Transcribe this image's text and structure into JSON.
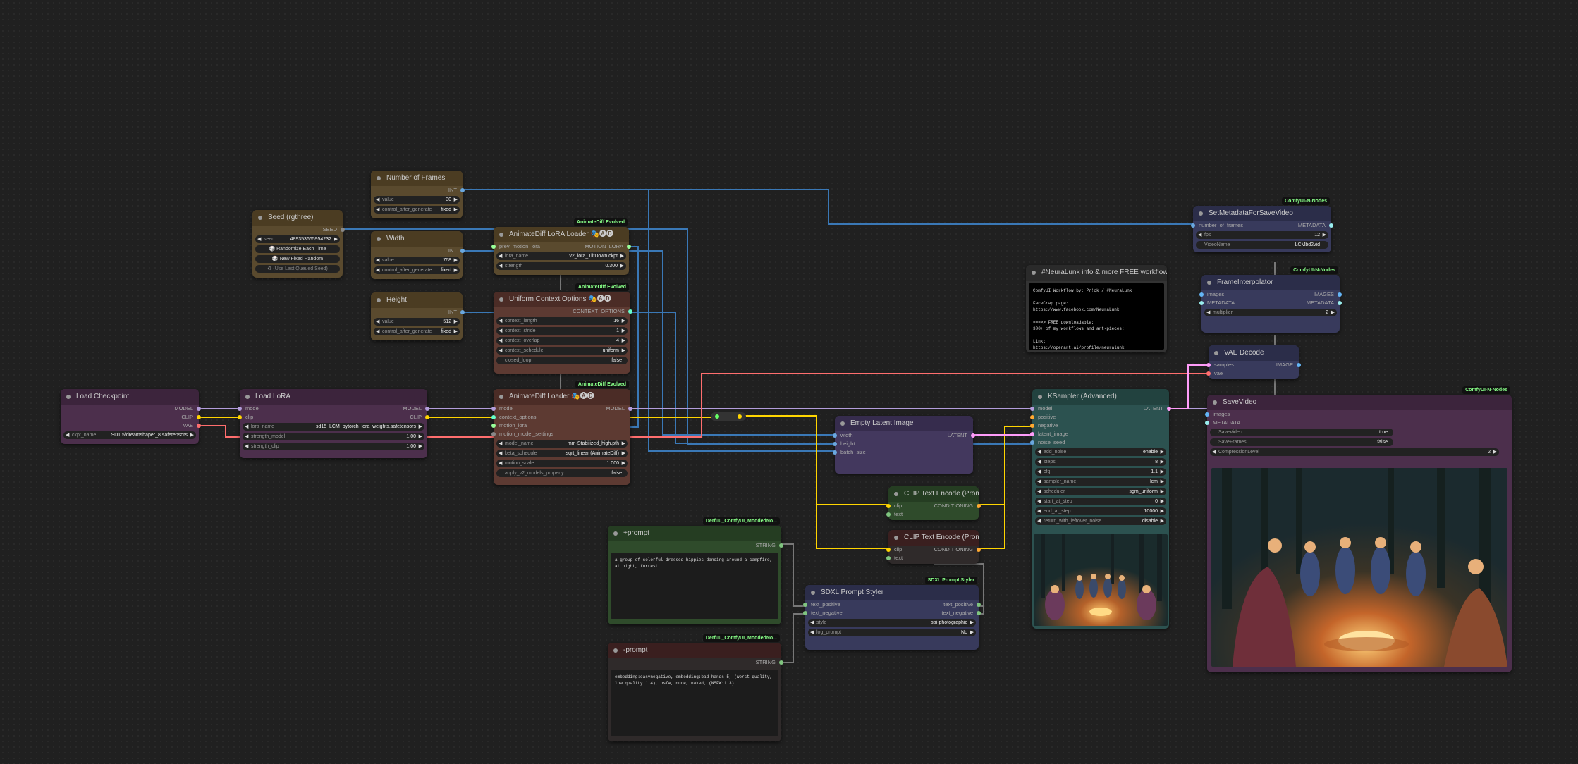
{
  "colors": {
    "wire_model": "#b39ddb",
    "wire_clip": "#ffd500",
    "wire_vae": "#ff6e6e",
    "wire_int": "#3a78b6",
    "wire_latent": "#ff9cf9",
    "wire_cond": "#ffa931",
    "wire_gray": "#777777"
  },
  "nodes": {
    "frames": {
      "title": "Number of Frames",
      "out": "INT",
      "w_value_k": "value",
      "w_value_v": "30",
      "w_cag_k": "control_after_generate",
      "w_cag_v": "fixed"
    },
    "seed": {
      "title": "Seed (rgthree)",
      "out": "SEED",
      "seed_k": "seed",
      "seed_v": "489353665954232",
      "btn1": "🎲 Randomize Each Time",
      "btn2": "🎲 New Fixed Random",
      "btn3": "♻ (Use Last Queued Seed)"
    },
    "width": {
      "title": "Width",
      "out": "INT",
      "w_value_k": "value",
      "w_value_v": "768",
      "w_cag_k": "control_after_generate",
      "w_cag_v": "fixed"
    },
    "height": {
      "title": "Height",
      "out": "INT",
      "w_value_k": "value",
      "w_value_v": "512",
      "w_cag_k": "control_after_generate",
      "w_cag_v": "fixed"
    },
    "lora_loader_ad": {
      "title": "AnimateDiff LoRA Loader 🎭🅐🅓",
      "badge": "AnimateDiff Evolved",
      "in1": "prev_motion_lora",
      "out1": "MOTION_LORA",
      "w1k": "lora_name",
      "w1v": "v2_lora_TiltDown.ckpt",
      "w2k": "strength",
      "w2v": "0.300"
    },
    "uco": {
      "title": "Uniform Context Options 🎭🅐🅓",
      "badge": "AnimateDiff Evolved",
      "out1": "CONTEXT_OPTIONS",
      "w1k": "context_length",
      "w1v": "16",
      "w2k": "context_stride",
      "w2v": "1",
      "w3k": "context_overlap",
      "w3v": "4",
      "w4k": "context_schedule",
      "w4v": "uniform",
      "w5k": "closed_loop",
      "w5v": "false"
    },
    "ckpt": {
      "title": "Load Checkpoint",
      "o1": "MODEL",
      "o2": "CLIP",
      "o3": "VAE",
      "wk": "ckpt_name",
      "wv": "SD1.5\\dreamshaper_8.safetensors"
    },
    "lora": {
      "title": "Load LoRA",
      "i1": "model",
      "i2": "clip",
      "o1": "MODEL",
      "o2": "CLIP",
      "w1k": "lora_name",
      "w1v": "sd15_LCM_pytorch_lora_weights.safetensors",
      "w2k": "strength_model",
      "w2v": "1.00",
      "w3k": "strength_clip",
      "w3v": "1.00"
    },
    "adloader": {
      "title": "AnimateDiff Loader 🎭🅐🅓",
      "badge": "AnimateDiff Evolved",
      "i1": "model",
      "i2": "context_options",
      "i3": "motion_lora",
      "i4": "motion_model_settings",
      "o1": "MODEL",
      "w1k": "model_name",
      "w1v": "mm-Stabilized_high.pth",
      "w2k": "beta_schedule",
      "w2v": "sqrt_linear (AnimateDiff)",
      "w3k": "motion_scale",
      "w3v": "1.000",
      "w4k": "apply_v2_models_properly",
      "w4v": "false"
    },
    "empty_latent": {
      "title": "Empty Latent Image",
      "i1": "width",
      "i2": "height",
      "i3": "batch_size",
      "o1": "LATENT"
    },
    "clip1": {
      "title": "CLIP Text Encode (Prompt)",
      "i1": "clip",
      "i2": "text",
      "o1": "CONDITIONING"
    },
    "clip2": {
      "title": "CLIP Text Encode (Prompt)",
      "i1": "clip",
      "i2": "text",
      "o1": "CONDITIONING"
    },
    "pos": {
      "title": "+prompt",
      "badge": "Derfuu_ComfyUI_ModdedNo...",
      "o1": "STRING",
      "text": "a group of colorful dressed hippies dancing around a campfire, at night, forrest,"
    },
    "neg": {
      "title": "-prompt",
      "badge": "Derfuu_ComfyUI_ModdedNo...",
      "o1": "STRING",
      "text": "embedding:easynegative, embedding:bad-hands-5, (worst quality, low quality:1.4), nsfw, nude, naked, (NSFW:1.3),"
    },
    "styler": {
      "title": "SDXL Prompt Styler",
      "badge": "SDXL Prompt Styler",
      "i1": "text_positive",
      "i2": "text_negative",
      "o1": "text_positive",
      "o2": "text_negative",
      "w1k": "style",
      "w1v": "sai-photographic",
      "w2k": "log_prompt",
      "w2v": "No"
    },
    "ksampler": {
      "title": "KSampler (Advanced)",
      "i1": "model",
      "i2": "positive",
      "i3": "negative",
      "i4": "latent_image",
      "i5": "noise_seed",
      "o1": "LATENT",
      "w": [
        [
          "add_noise",
          "enable"
        ],
        [
          "steps",
          "8"
        ],
        [
          "cfg",
          "1.1"
        ],
        [
          "sampler_name",
          "lcm"
        ],
        [
          "scheduler",
          "sgm_uniform"
        ],
        [
          "start_at_step",
          "0"
        ],
        [
          "end_at_step",
          "10000"
        ],
        [
          "return_with_leftover_noise",
          "disable"
        ]
      ]
    },
    "info": {
      "title": "#NeuraLunk info & more FREE workflows",
      "text": "ComfyUI Workflow by: Pr!ck / #NeuraLunk\n\nFaceCrap page:\nhttps://www.facebook.com/NeuraLunk\n\n===>> FREE downloadable:\n300+ of my workflows and art-pieces:\n\nLink:\nhttps://openart.ai/profile/neuralunk"
    },
    "setmeta": {
      "title": "SetMetadataForSaveVideo",
      "badge": "ComfyUI-N-Nodes",
      "i1": "number_of_frames",
      "o1": "METADATA",
      "w1k": "fps",
      "w1v": "12",
      "w2k": "VideoName",
      "w2v": "LCMbd2vid"
    },
    "interp": {
      "title": "FrameInterpolator",
      "badge": "ComfyUI-N-Nodes",
      "i1": "images",
      "i2": "METADATA",
      "o1": "IMAGES",
      "o2": "METADATA",
      "w1k": "multiplier",
      "w1v": "2"
    },
    "vae": {
      "title": "VAE Decode",
      "i1": "samples",
      "i2": "vae",
      "o1": "IMAGE"
    },
    "save": {
      "title": "SaveVideo",
      "badge": "ComfyUI-N-Nodes",
      "i1": "images",
      "i2": "METADATA",
      "w1k": "SaveVideo",
      "w1v": "true",
      "w2k": "SaveFrames",
      "w2v": "false",
      "w3k": "CompressionLevel",
      "w3v": "2"
    }
  },
  "reroute": {
    "label": ""
  },
  "icons": {
    "arrow_left": "◀",
    "arrow_right": "▶"
  }
}
